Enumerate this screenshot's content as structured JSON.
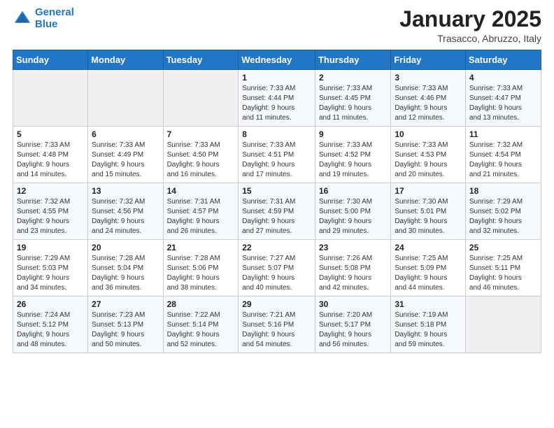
{
  "header": {
    "logo_line1": "General",
    "logo_line2": "Blue",
    "month": "January 2025",
    "location": "Trasacco, Abruzzo, Italy"
  },
  "weekdays": [
    "Sunday",
    "Monday",
    "Tuesday",
    "Wednesday",
    "Thursday",
    "Friday",
    "Saturday"
  ],
  "weeks": [
    [
      {
        "day": "",
        "info": ""
      },
      {
        "day": "",
        "info": ""
      },
      {
        "day": "",
        "info": ""
      },
      {
        "day": "1",
        "info": "Sunrise: 7:33 AM\nSunset: 4:44 PM\nDaylight: 9 hours\nand 11 minutes."
      },
      {
        "day": "2",
        "info": "Sunrise: 7:33 AM\nSunset: 4:45 PM\nDaylight: 9 hours\nand 11 minutes."
      },
      {
        "day": "3",
        "info": "Sunrise: 7:33 AM\nSunset: 4:46 PM\nDaylight: 9 hours\nand 12 minutes."
      },
      {
        "day": "4",
        "info": "Sunrise: 7:33 AM\nSunset: 4:47 PM\nDaylight: 9 hours\nand 13 minutes."
      }
    ],
    [
      {
        "day": "5",
        "info": "Sunrise: 7:33 AM\nSunset: 4:48 PM\nDaylight: 9 hours\nand 14 minutes."
      },
      {
        "day": "6",
        "info": "Sunrise: 7:33 AM\nSunset: 4:49 PM\nDaylight: 9 hours\nand 15 minutes."
      },
      {
        "day": "7",
        "info": "Sunrise: 7:33 AM\nSunset: 4:50 PM\nDaylight: 9 hours\nand 16 minutes."
      },
      {
        "day": "8",
        "info": "Sunrise: 7:33 AM\nSunset: 4:51 PM\nDaylight: 9 hours\nand 17 minutes."
      },
      {
        "day": "9",
        "info": "Sunrise: 7:33 AM\nSunset: 4:52 PM\nDaylight: 9 hours\nand 19 minutes."
      },
      {
        "day": "10",
        "info": "Sunrise: 7:33 AM\nSunset: 4:53 PM\nDaylight: 9 hours\nand 20 minutes."
      },
      {
        "day": "11",
        "info": "Sunrise: 7:32 AM\nSunset: 4:54 PM\nDaylight: 9 hours\nand 21 minutes."
      }
    ],
    [
      {
        "day": "12",
        "info": "Sunrise: 7:32 AM\nSunset: 4:55 PM\nDaylight: 9 hours\nand 23 minutes."
      },
      {
        "day": "13",
        "info": "Sunrise: 7:32 AM\nSunset: 4:56 PM\nDaylight: 9 hours\nand 24 minutes."
      },
      {
        "day": "14",
        "info": "Sunrise: 7:31 AM\nSunset: 4:57 PM\nDaylight: 9 hours\nand 26 minutes."
      },
      {
        "day": "15",
        "info": "Sunrise: 7:31 AM\nSunset: 4:59 PM\nDaylight: 9 hours\nand 27 minutes."
      },
      {
        "day": "16",
        "info": "Sunrise: 7:30 AM\nSunset: 5:00 PM\nDaylight: 9 hours\nand 29 minutes."
      },
      {
        "day": "17",
        "info": "Sunrise: 7:30 AM\nSunset: 5:01 PM\nDaylight: 9 hours\nand 30 minutes."
      },
      {
        "day": "18",
        "info": "Sunrise: 7:29 AM\nSunset: 5:02 PM\nDaylight: 9 hours\nand 32 minutes."
      }
    ],
    [
      {
        "day": "19",
        "info": "Sunrise: 7:29 AM\nSunset: 5:03 PM\nDaylight: 9 hours\nand 34 minutes."
      },
      {
        "day": "20",
        "info": "Sunrise: 7:28 AM\nSunset: 5:04 PM\nDaylight: 9 hours\nand 36 minutes."
      },
      {
        "day": "21",
        "info": "Sunrise: 7:28 AM\nSunset: 5:06 PM\nDaylight: 9 hours\nand 38 minutes."
      },
      {
        "day": "22",
        "info": "Sunrise: 7:27 AM\nSunset: 5:07 PM\nDaylight: 9 hours\nand 40 minutes."
      },
      {
        "day": "23",
        "info": "Sunrise: 7:26 AM\nSunset: 5:08 PM\nDaylight: 9 hours\nand 42 minutes."
      },
      {
        "day": "24",
        "info": "Sunrise: 7:25 AM\nSunset: 5:09 PM\nDaylight: 9 hours\nand 44 minutes."
      },
      {
        "day": "25",
        "info": "Sunrise: 7:25 AM\nSunset: 5:11 PM\nDaylight: 9 hours\nand 46 minutes."
      }
    ],
    [
      {
        "day": "26",
        "info": "Sunrise: 7:24 AM\nSunset: 5:12 PM\nDaylight: 9 hours\nand 48 minutes."
      },
      {
        "day": "27",
        "info": "Sunrise: 7:23 AM\nSunset: 5:13 PM\nDaylight: 9 hours\nand 50 minutes."
      },
      {
        "day": "28",
        "info": "Sunrise: 7:22 AM\nSunset: 5:14 PM\nDaylight: 9 hours\nand 52 minutes."
      },
      {
        "day": "29",
        "info": "Sunrise: 7:21 AM\nSunset: 5:16 PM\nDaylight: 9 hours\nand 54 minutes."
      },
      {
        "day": "30",
        "info": "Sunrise: 7:20 AM\nSunset: 5:17 PM\nDaylight: 9 hours\nand 56 minutes."
      },
      {
        "day": "31",
        "info": "Sunrise: 7:19 AM\nSunset: 5:18 PM\nDaylight: 9 hours\nand 59 minutes."
      },
      {
        "day": "",
        "info": ""
      }
    ]
  ]
}
